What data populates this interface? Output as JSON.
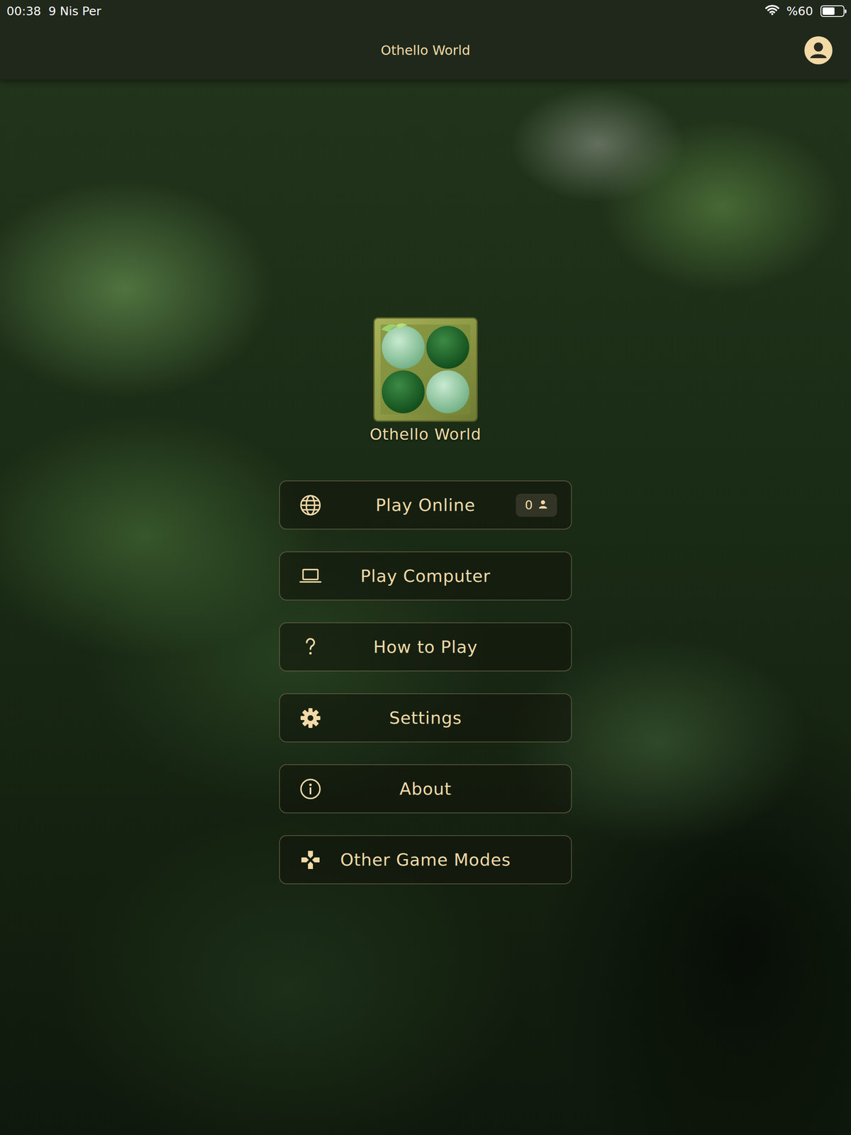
{
  "status_bar": {
    "time": "00:38",
    "date": "9 Nis Per",
    "battery": "%60",
    "battery_level": 0.6
  },
  "nav": {
    "title": "Othello World"
  },
  "app": {
    "name": "Othello World"
  },
  "menu": [
    {
      "label": "Play Online",
      "badge": "0"
    },
    {
      "label": "Play Computer"
    },
    {
      "label": "How to Play"
    },
    {
      "label": "Settings"
    },
    {
      "label": "About"
    },
    {
      "label": "Other Game Modes"
    }
  ]
}
